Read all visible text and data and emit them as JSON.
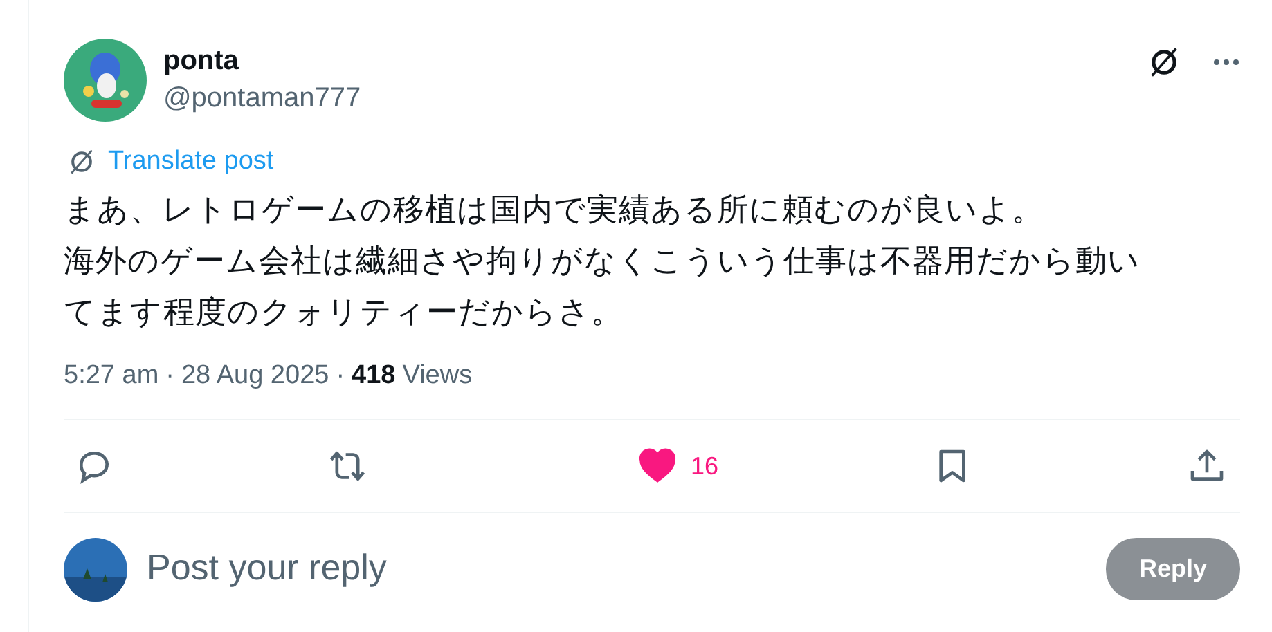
{
  "post": {
    "author": {
      "name": "ponta",
      "handle": "@pontaman777"
    },
    "translate_link": "Translate post",
    "body": [
      "まあ、レトロゲームの移植は国内で実績ある所に頼むのが良いよ。",
      "海外のゲーム会社は繊細さや拘りがなくこういう仕事は不器用だから動いてます程度のクォリティーだからさ。"
    ],
    "time": "5:27 am",
    "separators": [
      "·",
      "·"
    ],
    "date": "28 Aug 2025",
    "views_count": "418",
    "views_label": "Views",
    "actions": [
      {
        "kind": "reply"
      },
      {
        "kind": "repost"
      },
      {
        "kind": "like",
        "selected": true,
        "count": "16"
      },
      {
        "kind": "bookmark"
      },
      {
        "kind": "share"
      }
    ]
  },
  "reply_box": {
    "placeholder": "Post your reply",
    "button": "Reply"
  }
}
